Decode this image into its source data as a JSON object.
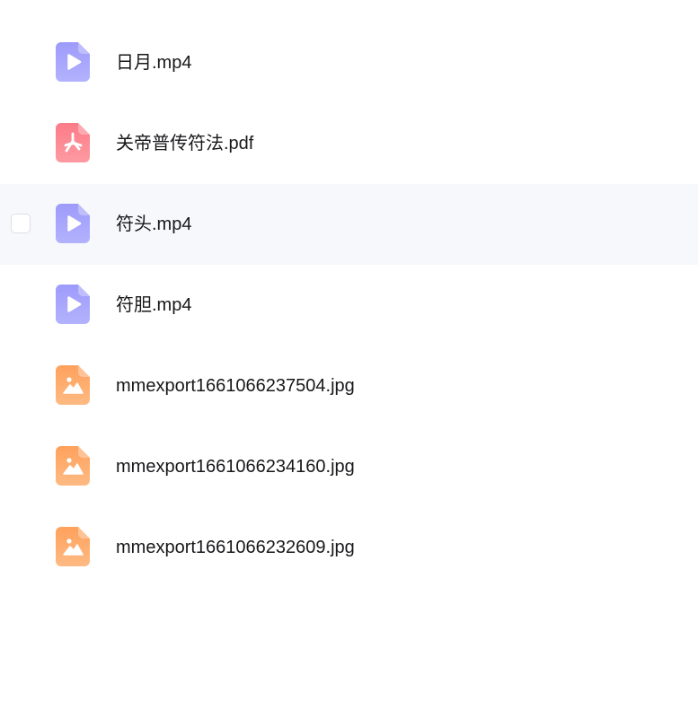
{
  "files": [
    {
      "name": "日月.mp4",
      "type": "video",
      "icon": "video-file-icon",
      "color_top": "#9d9bfa",
      "color_bottom": "#b3b2fd"
    },
    {
      "name": "关帝普传符法.pdf",
      "type": "pdf",
      "icon": "pdf-file-icon",
      "color_top": "#fb7b87",
      "color_bottom": "#fd9aa2"
    },
    {
      "name": "符头.mp4",
      "type": "video",
      "icon": "video-file-icon",
      "color_top": "#9d9bfa",
      "color_bottom": "#b3b2fd",
      "hovered": true
    },
    {
      "name": "符胆.mp4",
      "type": "video",
      "icon": "video-file-icon",
      "color_top": "#9d9bfa",
      "color_bottom": "#b3b2fd"
    },
    {
      "name": "mmexport1661066237504.jpg",
      "type": "image",
      "icon": "image-file-icon",
      "color_top": "#fea15c",
      "color_bottom": "#feba83"
    },
    {
      "name": "mmexport1661066234160.jpg",
      "type": "image",
      "icon": "image-file-icon",
      "color_top": "#fea15c",
      "color_bottom": "#feba83"
    },
    {
      "name": "mmexport1661066232609.jpg",
      "type": "image",
      "icon": "image-file-icon",
      "color_top": "#fea15c",
      "color_bottom": "#feba83"
    }
  ]
}
